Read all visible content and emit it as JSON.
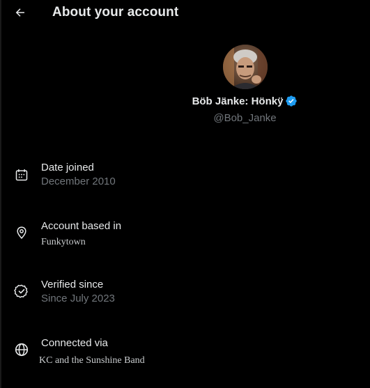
{
  "header": {
    "title": "About your account"
  },
  "profile": {
    "display_name": "Böb Jänke: Hönkÿ",
    "handle": "@Bob_Janke",
    "verified": true
  },
  "details": [
    {
      "label": "Date joined",
      "value": "December 2010",
      "icon": "calendar-icon"
    },
    {
      "label": "Account based in",
      "value": "Funkytown",
      "icon": "location-pin-icon"
    },
    {
      "label": "Verified since",
      "value": "Since July 2023",
      "icon": "verified-check-icon"
    },
    {
      "label": "Connected via",
      "value": "KC and the Sunshine Band",
      "icon": "globe-icon"
    }
  ],
  "colors": {
    "background": "#000000",
    "text_primary": "#e7e9ea",
    "text_secondary": "#71767b",
    "verified_blue": "#1d9bf0"
  }
}
